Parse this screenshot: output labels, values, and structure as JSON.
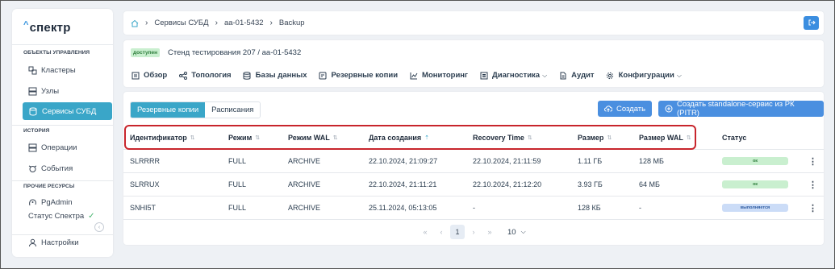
{
  "colors": {
    "accent": "#3aa6c8",
    "primary_button": "#4a8fe0",
    "highlight_border": "#c8252c",
    "ok_badge": "#c9efcf",
    "running_badge": "#cbdcf7"
  },
  "app": {
    "logo": "спектр"
  },
  "sidebar": {
    "sections": [
      {
        "title": "ОБЪЕКТЫ УПРАВЛЕНИЯ",
        "items": [
          {
            "label": "Кластеры",
            "icon": "cluster-icon"
          },
          {
            "label": "Узлы",
            "icon": "server-icon"
          },
          {
            "label": "Сервисы СУБД",
            "icon": "database-service-icon",
            "active": true
          }
        ]
      },
      {
        "title": "ИСТОРИЯ",
        "items": [
          {
            "label": "Операции",
            "icon": "operations-icon"
          },
          {
            "label": "События",
            "icon": "events-icon"
          }
        ]
      },
      {
        "title": "ПРОЧИЕ РЕСУРСЫ",
        "items": [
          {
            "label": "PgAdmin",
            "icon": "pgadmin-icon"
          },
          {
            "label": "Статус Спектра",
            "icon": "check-icon"
          }
        ]
      }
    ],
    "settings_label": "Настройки"
  },
  "breadcrumbs": [
    "Сервисы СУБД",
    "aa-01-5432",
    "Backup"
  ],
  "header": {
    "status": "доступен",
    "stand": "Стенд тестирования 207 /  aa-01-5432",
    "nav": [
      {
        "label": "Обзор",
        "icon": "overview-icon"
      },
      {
        "label": "Топология",
        "icon": "topology-icon"
      },
      {
        "label": "Базы данных",
        "icon": "database-icon"
      },
      {
        "label": "Резервные копии",
        "icon": "backup-icon"
      },
      {
        "label": "Мониторинг",
        "icon": "chart-icon"
      },
      {
        "label": "Диагностика",
        "icon": "diagnostics-icon",
        "dropdown": true
      },
      {
        "label": "Аудит",
        "icon": "audit-icon"
      },
      {
        "label": "Конфигурации",
        "icon": "gear-icon",
        "dropdown": true
      }
    ]
  },
  "tabs": [
    "Резервные копии",
    "Расписания"
  ],
  "buttons": {
    "create": "Создать",
    "create_standalone": "Создать standalone-сервис из РК (PITR)"
  },
  "table": {
    "columns": [
      "Идентификатор",
      "Режим",
      "Режим WAL",
      "Дата создания",
      "Recovery Time",
      "Размер",
      "Размер WAL",
      "Статус"
    ],
    "rows": [
      {
        "id": "SLRRRR",
        "mode": "FULL",
        "wal_mode": "ARCHIVE",
        "created": "22.10.2024, 21:09:27",
        "recovery": "22.10.2024, 21:11:59",
        "size": "1.11 ГБ",
        "wal_size": "128 МБ",
        "status": "ок",
        "status_kind": "ok"
      },
      {
        "id": "SLRRUX",
        "mode": "FULL",
        "wal_mode": "ARCHIVE",
        "created": "22.10.2024, 21:11:21",
        "recovery": "22.10.2024, 21:12:20",
        "size": "3.93 ГБ",
        "wal_size": "64 МБ",
        "status": "ок",
        "status_kind": "ok"
      },
      {
        "id": "SNHI5T",
        "mode": "FULL",
        "wal_mode": "ARCHIVE",
        "created": "25.11.2024, 05:13:05",
        "recovery": "-",
        "size": "128 КБ",
        "wal_size": "-",
        "status": "выполняется",
        "status_kind": "running"
      }
    ]
  },
  "pagination": {
    "current_page": "1",
    "page_size": "10"
  }
}
